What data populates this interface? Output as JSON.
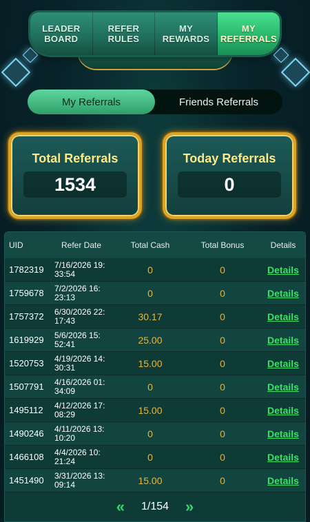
{
  "nav": {
    "tabs": [
      {
        "label": "LEADER\nBOARD",
        "active": false
      },
      {
        "label": "REFER\nRULES",
        "active": false
      },
      {
        "label": "MY\nREWARDS",
        "active": false
      },
      {
        "label": "MY\nREFERRALS",
        "active": true
      }
    ]
  },
  "segment": {
    "my_referrals": "My Referrals",
    "friends_referrals": "Friends Referrals"
  },
  "stats": {
    "total_label": "Total Referrals",
    "total_value": "1534",
    "today_label": "Today Referrals",
    "today_value": "0"
  },
  "table": {
    "headers": [
      "UID",
      "Refer Date",
      "Total Cash",
      "Total Bonus",
      "Details"
    ],
    "rows": [
      {
        "uid": "1782319",
        "date": "7/16/2026 19:\n33:54",
        "cash": "0",
        "bonus": "0",
        "details": "Details"
      },
      {
        "uid": "1759678",
        "date": "7/2/2026 16:\n23:13",
        "cash": "0",
        "bonus": "0",
        "details": "Details"
      },
      {
        "uid": "1757372",
        "date": "6/30/2026 22:\n17:43",
        "cash": "30.17",
        "bonus": "0",
        "details": "Details"
      },
      {
        "uid": "1619929",
        "date": "5/6/2026 15:\n52:41",
        "cash": "25.00",
        "bonus": "0",
        "details": "Details"
      },
      {
        "uid": "1520753",
        "date": "4/19/2026 14:\n30:31",
        "cash": "15.00",
        "bonus": "0",
        "details": "Details"
      },
      {
        "uid": "1507791",
        "date": "4/16/2026 01:\n34:09",
        "cash": "0",
        "bonus": "0",
        "details": "Details"
      },
      {
        "uid": "1495112",
        "date": "4/12/2026 17:\n08:29",
        "cash": "15.00",
        "bonus": "0",
        "details": "Details"
      },
      {
        "uid": "1490246",
        "date": "4/11/2026 13:\n10:20",
        "cash": "0",
        "bonus": "0",
        "details": "Details"
      },
      {
        "uid": "1466108",
        "date": "4/4/2026 10:\n21:24",
        "cash": "0",
        "bonus": "0",
        "details": "Details"
      },
      {
        "uid": "1451490",
        "date": "3/31/2026 13:\n09:14",
        "cash": "15.00",
        "bonus": "0",
        "details": "Details"
      }
    ]
  },
  "pager": {
    "prev_icon": "double-chevron-left-icon",
    "next_icon": "double-chevron-right-icon",
    "prev_glyph": "«",
    "next_glyph": "»",
    "page_text": "1/154"
  },
  "colors": {
    "accent_green": "#36d66a",
    "gold": "#d9a526",
    "cash_text": "#e8b640"
  }
}
